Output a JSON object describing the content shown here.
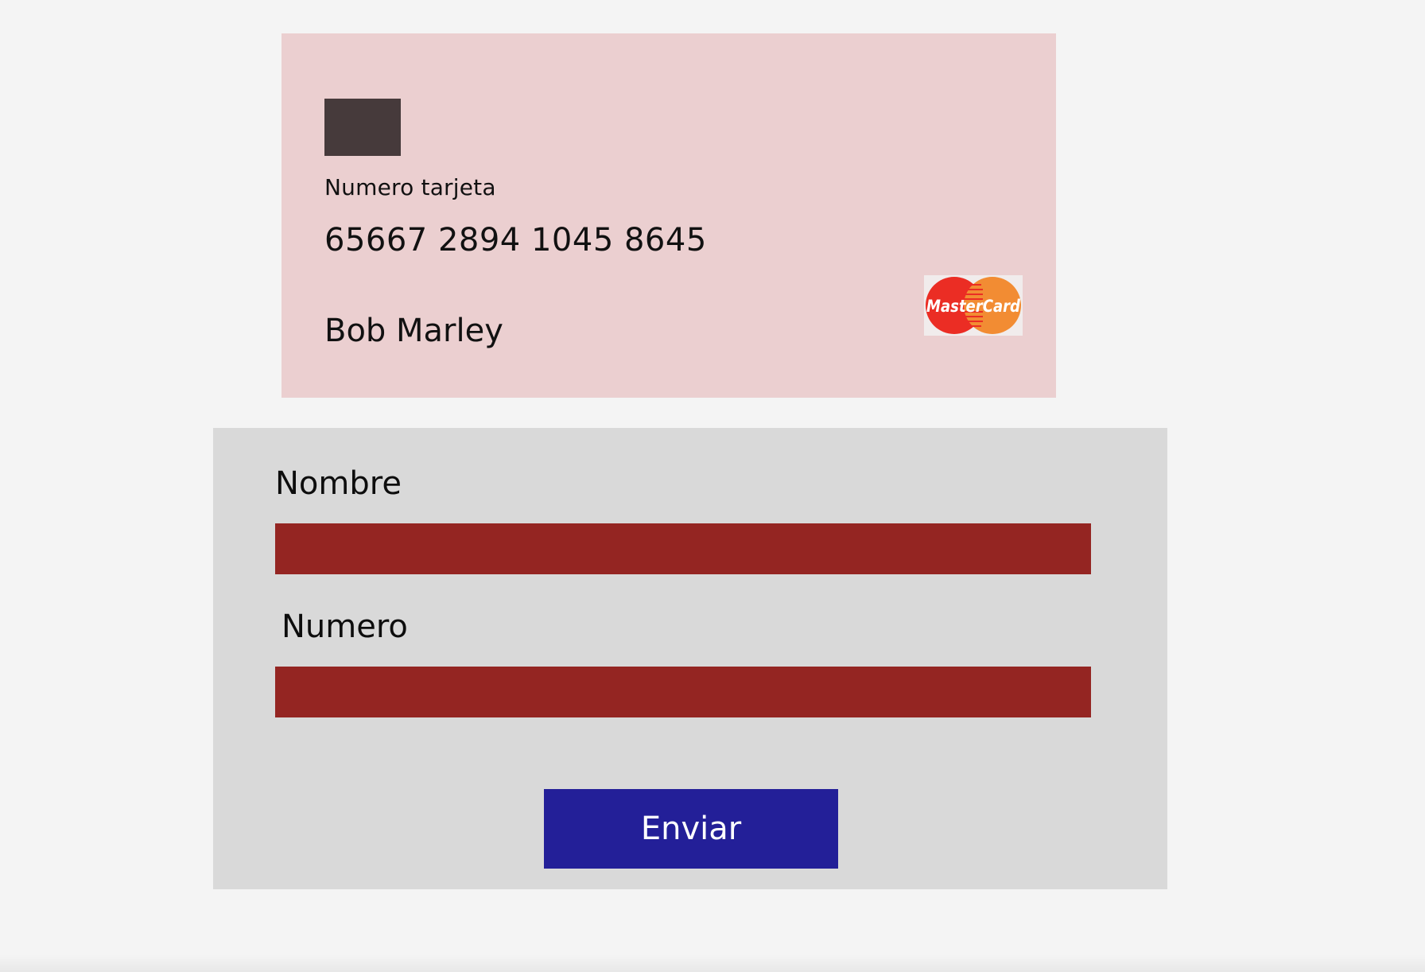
{
  "card": {
    "number_label": "Numero tarjeta",
    "number": "65667 2894 1045 8645",
    "holder_name": "Bob Marley",
    "brand": {
      "icon": "mastercard-logo",
      "text": "MasterCard",
      "colors": {
        "red": "#eb2d24",
        "orange": "#f28c33"
      }
    },
    "colors": {
      "background": "#ebcfd0",
      "chip": "#463a3b"
    }
  },
  "form": {
    "fields": [
      {
        "label": "Nombre",
        "value": ""
      },
      {
        "label": "Numero",
        "value": ""
      }
    ],
    "submit_label": "Enviar",
    "colors": {
      "background": "#d9d9d9",
      "input": "#942522",
      "button": "#231f98",
      "button_text": "#ffffff"
    }
  },
  "page": {
    "background": "#f4f4f4"
  }
}
